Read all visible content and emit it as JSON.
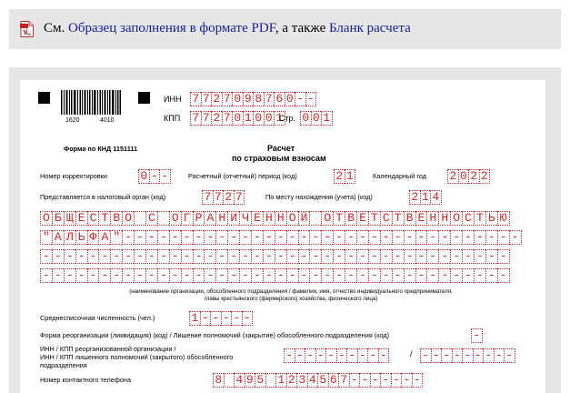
{
  "top": {
    "prefix": "См. ",
    "link1": "Образец заполнения в формате PDF",
    "middle": ", а также ",
    "link2": "Бланк расчета"
  },
  "form": {
    "barcode_left": "1620",
    "barcode_right": "4010",
    "inn_label": "ИНН",
    "inn_cells": "7727098760--",
    "kpp_label": "КПП",
    "kpp_cells": "772701001",
    "page_label": "Стр.",
    "page_cells": "001",
    "knd": "Форма по КНД 1151111",
    "title_line1": "Расчет",
    "title_line2": "по страховым взносам",
    "correction_label": "Номер корректировки",
    "correction_cells": "0--",
    "period_label": "Расчетный (отчетный) период (код)",
    "period_cells": "21",
    "year_label": "Календарный год",
    "year_cells": "2022",
    "tax_authority_label": "Представляется в налоговый орган (код)",
    "tax_authority_cells": "7727",
    "location_label": "По месту нахождения (учета) (код)",
    "location_cells": "214",
    "org_rows": [
      "ОБЩЕСТВО С ОГРАНИЧЕННОЙ ОТВЕТСТВЕННОСТЬЮ",
      "\"АЛЬФА\"----------------------------------",
      "----------------------------------------",
      "----------------------------------------"
    ],
    "org_caption_line1": "(наименование организации, обособленного подразделения / фамилия, имя, отчество индивидуального предпринимателя,",
    "org_caption_line2": "главы крестьянского (фермерского) хозяйства, физического лица)",
    "headcount_label": "Среднесписочная численность (чел.)",
    "headcount_cells": "1-----",
    "reorg_label": "Форма реорганизации (ликвидация) (код) / Лишение полномочий (закрытие) обособленного подразделения (код)",
    "reorg_cells": "-",
    "inn_kpp_reorg_label_line1": "ИНН / КПП реорганизованной организации /",
    "inn_kpp_reorg_label_line2": "ИНН / КПП лишенного полномочий (закрытого) обособленного",
    "inn_kpp_reorg_label_line3": "подразделения",
    "inn_reorg_cells": "----------",
    "slash": "/",
    "kpp_reorg_cells": "---------",
    "phone_label": "Номер контактного телефона",
    "phone_cells": "8 495 1234567-------"
  }
}
